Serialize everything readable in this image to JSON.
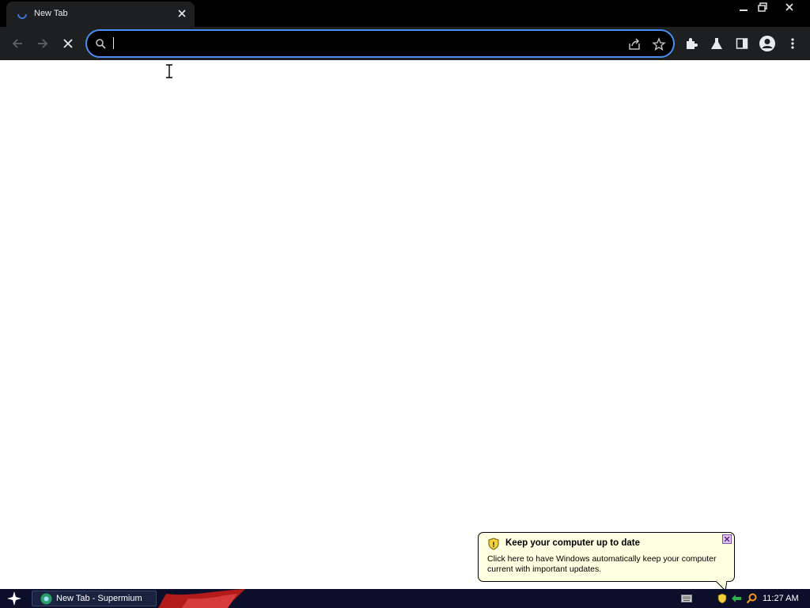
{
  "browser": {
    "tab": {
      "title": "New Tab"
    },
    "omnibox": {
      "value": "",
      "placeholder": ""
    }
  },
  "balloon": {
    "title": "Keep your computer up to date",
    "body": "Click here to have Windows automatically keep your computer current with important updates."
  },
  "taskbar": {
    "task_label": "New Tab - Supermium",
    "clock": "11:27 AM"
  },
  "colors": {
    "accent": "#4a8ff0",
    "toolbar_bg": "#1e1f21",
    "page_bg": "#ffffff",
    "balloon_bg": "#ffffe1"
  },
  "icons": [
    "tab-loading-icon",
    "tab-close-icon",
    "minimize-icon",
    "restore-icon",
    "window-close-icon",
    "back-icon",
    "forward-icon",
    "stop-icon",
    "search-icon",
    "share-icon",
    "bookmark-star-icon",
    "extensions-icon",
    "labs-icon",
    "side-panel-icon",
    "profile-icon",
    "menu-icon",
    "shield-icon",
    "start-icon",
    "keyboard-icon",
    "security-icon",
    "network-icon",
    "search-tray-icon"
  ]
}
